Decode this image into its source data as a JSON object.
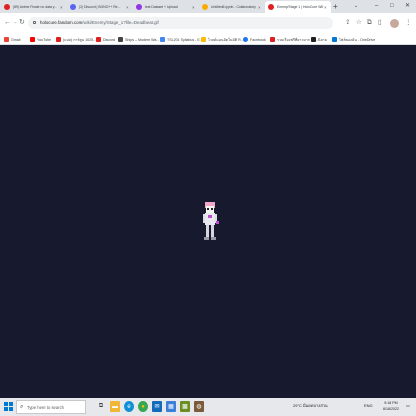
{
  "tabs": [
    {
      "title": "(89) Anime Finale no data y...",
      "favicon_color": "#e02020",
      "active": false
    },
    {
      "title": "(2) Discord | BONO++ Re...",
      "favicon_color": "#5865f2",
      "active": false
    },
    {
      "title": "test Dataset + Upload",
      "favicon_color": "#9334e6",
      "active": false
    },
    {
      "title": "Untitled6.ipynb - Colaboratory",
      "favicon_color": "#f9ab00",
      "active": false
    },
    {
      "title": "Enemy/Stage 1 | HoloCure Wiki",
      "favicon_color": "#e02020",
      "active": true
    }
  ],
  "tab_close": "×",
  "new_tab": "+",
  "tab_search": "⌄",
  "window": {
    "minimize": "–",
    "maximize": "□",
    "close": "✕"
  },
  "toolbar": {
    "back": "←",
    "forward": "→",
    "reload": "↻",
    "url_host": "holocure.fandom.com",
    "url_path": "/wiki/Enemy/Stage_1?file=Deadbeat.gif",
    "share": "⇪",
    "star": "☆",
    "extensions": "⧉",
    "sidepanel": "▯",
    "menu": "⋮"
  },
  "bookmarks": [
    {
      "label": "Gmail",
      "color": "#ea4335"
    },
    {
      "label": "YouTube",
      "color": "#ff0000"
    },
    {
      "label": "(แปล) การ์ตูน 1025...",
      "color": "#e02020"
    },
    {
      "label": "Discord",
      "color": "#e02020"
    },
    {
      "label": "Ships – Modern Wa...",
      "color": "#444444"
    },
    {
      "label": "TSL201 Syllabus - E...",
      "color": "#4285f4"
    },
    {
      "label": "ไวลด์แมนอัตโนมัติ R...",
      "color": "#fbbc04"
    },
    {
      "label": "Facebook",
      "color": "#1877f2"
    },
    {
      "label": "รวมเรื่องฟรีที่ยาวมาก - ส...",
      "color": "#e02020"
    },
    {
      "label": "นิยาย",
      "color": "#202124"
    },
    {
      "label": "ไฟล์ของฉัน - OneDrive",
      "color": "#0078d4"
    }
  ],
  "taskbar": {
    "search_placeholder": "Type here to search",
    "apps": [
      {
        "icon": "task-view-icon",
        "glyph": "⧉",
        "color": "#3c3c3c"
      },
      {
        "icon": "file-explorer-icon",
        "glyph": "▬",
        "color": "#f2b635"
      },
      {
        "icon": "edge-icon",
        "glyph": "e",
        "color": "#0f8fd6"
      },
      {
        "icon": "chrome-icon",
        "glyph": "●",
        "color": "#34a853"
      },
      {
        "icon": "mail-icon",
        "glyph": "✉",
        "color": "#0f6cbd"
      },
      {
        "icon": "store-icon",
        "glyph": "▦",
        "color": "#3b7fd9"
      },
      {
        "icon": "minecraft-icon",
        "glyph": "▩",
        "color": "#6b8e23"
      },
      {
        "icon": "app-icon",
        "glyph": "◍",
        "color": "#7a5c3a"
      }
    ],
    "weather": "29°C มีแดดบางส่วน",
    "language": "ENG",
    "time": "9:18 PM",
    "date": "8/18/2022"
  }
}
